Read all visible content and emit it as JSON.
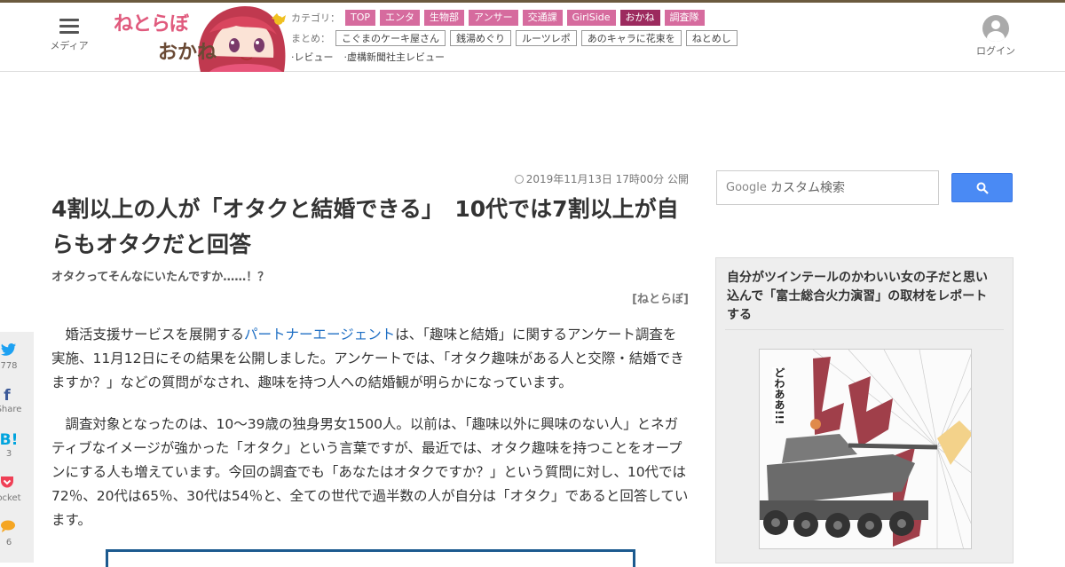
{
  "header": {
    "menu_label": "メディア",
    "logo_line1": "ねとらぼ",
    "logo_line2": "おかね",
    "category_label": "カテゴリ：",
    "categories": [
      "TOP",
      "エンタ",
      "生物部",
      "アンサー",
      "交通課",
      "GirlSide",
      "おかね",
      "調査隊"
    ],
    "active_category": "おかね",
    "summary_label": "まとめ：",
    "summaries": [
      "こぐまのケーキ屋さん",
      "銭湯めぐり",
      "ルーツレポ",
      "あのキャラに花束を",
      "ねとめし"
    ],
    "reviews": [
      "·レビュー",
      "·虚構新聞社主レビュー"
    ],
    "login_label": "ログイン"
  },
  "article": {
    "date": "2019年11月13日 17時00分 公開",
    "title": "4割以上の人が「オタクと結婚できる」　10代では7割以上が自らもオタクだと回答",
    "subtitle": "オタクってそんなにいたんですか……！？",
    "source": "[ねとらぼ]",
    "p1_before": "婚活支援サービスを展開する",
    "p1_link": "パートナーエージェント",
    "p1_after": "は、「趣味と結婚」に関するアンケート調査を実施、11月12日にその結果を公開しました。アンケートでは、「オタク趣味がある人と交際・結婚できますか？」などの質問がなされ、趣味を持つ人への結婚観が明らかになっています。",
    "p2": "調査対象となったのは、10～39歳の独身男女1500人。以前は、「趣味以外に興味のない人」とネガティブなイメージが強かった「オタク」という言葉ですが、最近では、オタク趣味を持つことをオープンにする人も増えています。今回の調査でも「あなたはオタクですか？」という質問に対し、10代では72％、20代は65％、30代は54％と、全ての世代で過半数の人が自分は「オタク」であると回答しています。"
  },
  "share": [
    {
      "icon": "twitter-icon",
      "count": "778",
      "color": "#1da1f2"
    },
    {
      "icon": "facebook-icon",
      "count": "Share",
      "color": "#3b5998"
    },
    {
      "icon": "hatena-icon",
      "count": "3",
      "color": "#00a4de"
    },
    {
      "icon": "pocket-icon",
      "count": "ocket",
      "color": "#ef4056"
    },
    {
      "icon": "comment-icon",
      "count": "6",
      "color": "#f5a623"
    }
  ],
  "sidebar": {
    "search_brand": "Google",
    "search_placeholder": "カスタム検索",
    "card_title": "自分がツインテールのかわいい女の子だと思い込んで「富士総合火力演習」の取材をレポートする",
    "manga_text": "どわああ!!!"
  }
}
